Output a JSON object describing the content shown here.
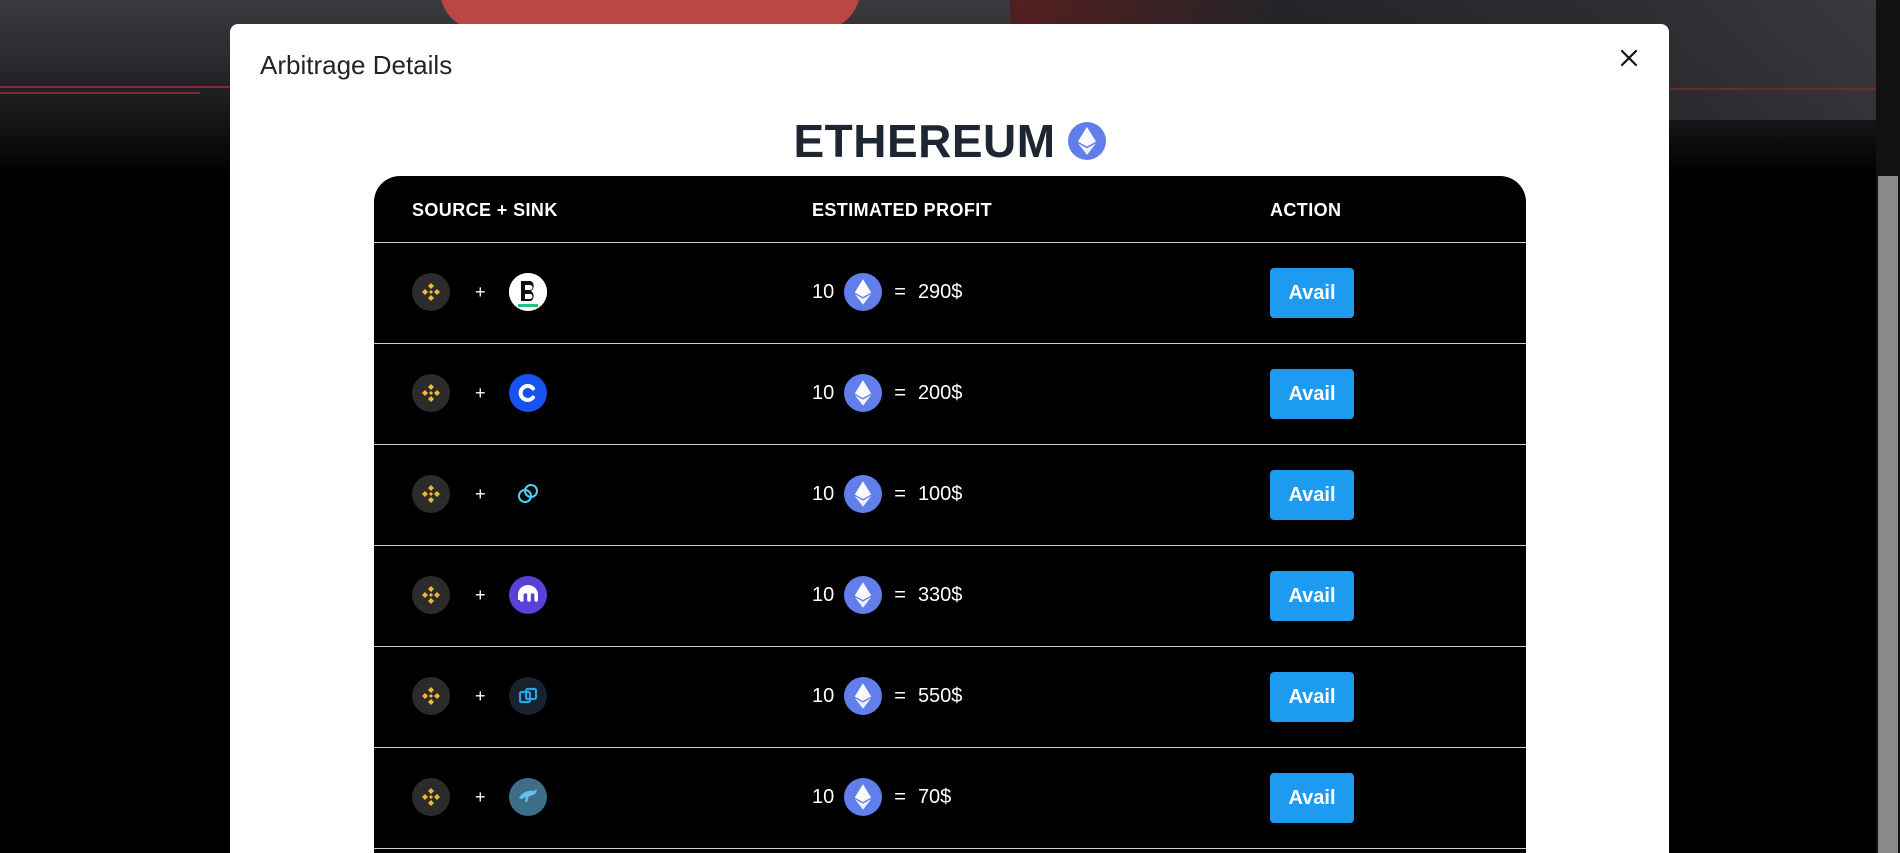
{
  "modal": {
    "title": "Arbitrage Details",
    "close_icon": "close-icon"
  },
  "coin": {
    "name": "ETHEREUM",
    "icon": "ethereum-icon",
    "color": "#627eea"
  },
  "table": {
    "headers": {
      "source_sink": "SOURCE + SINK",
      "estimated_profit": "ESTIMATED PROFIT",
      "action": "ACTION"
    },
    "rows": [
      {
        "source": "binance-icon",
        "plus": "+",
        "sink": "bitget-icon",
        "amount": "10",
        "eq": "=",
        "profit": "290$",
        "action": "Avail"
      },
      {
        "source": "binance-icon",
        "plus": "+",
        "sink": "coinbase-icon",
        "amount": "10",
        "eq": "=",
        "profit": "200$",
        "action": "Avail"
      },
      {
        "source": "binance-icon",
        "plus": "+",
        "sink": "gemini-icon",
        "amount": "10",
        "eq": "=",
        "profit": "100$",
        "action": "Avail"
      },
      {
        "source": "binance-icon",
        "plus": "+",
        "sink": "kraken-icon",
        "amount": "10",
        "eq": "=",
        "profit": "330$",
        "action": "Avail"
      },
      {
        "source": "binance-icon",
        "plus": "+",
        "sink": "bitfinex-icon",
        "amount": "10",
        "eq": "=",
        "profit": "550$",
        "action": "Avail"
      },
      {
        "source": "binance-icon",
        "plus": "+",
        "sink": "kucoin-icon",
        "amount": "10",
        "eq": "=",
        "profit": "70$",
        "action": "Avail"
      }
    ]
  },
  "colors": {
    "avail_button": "#1d9bf0",
    "binance": "#f3ba2f",
    "coinbase": "#1652f0",
    "kraken": "#5741d9"
  }
}
